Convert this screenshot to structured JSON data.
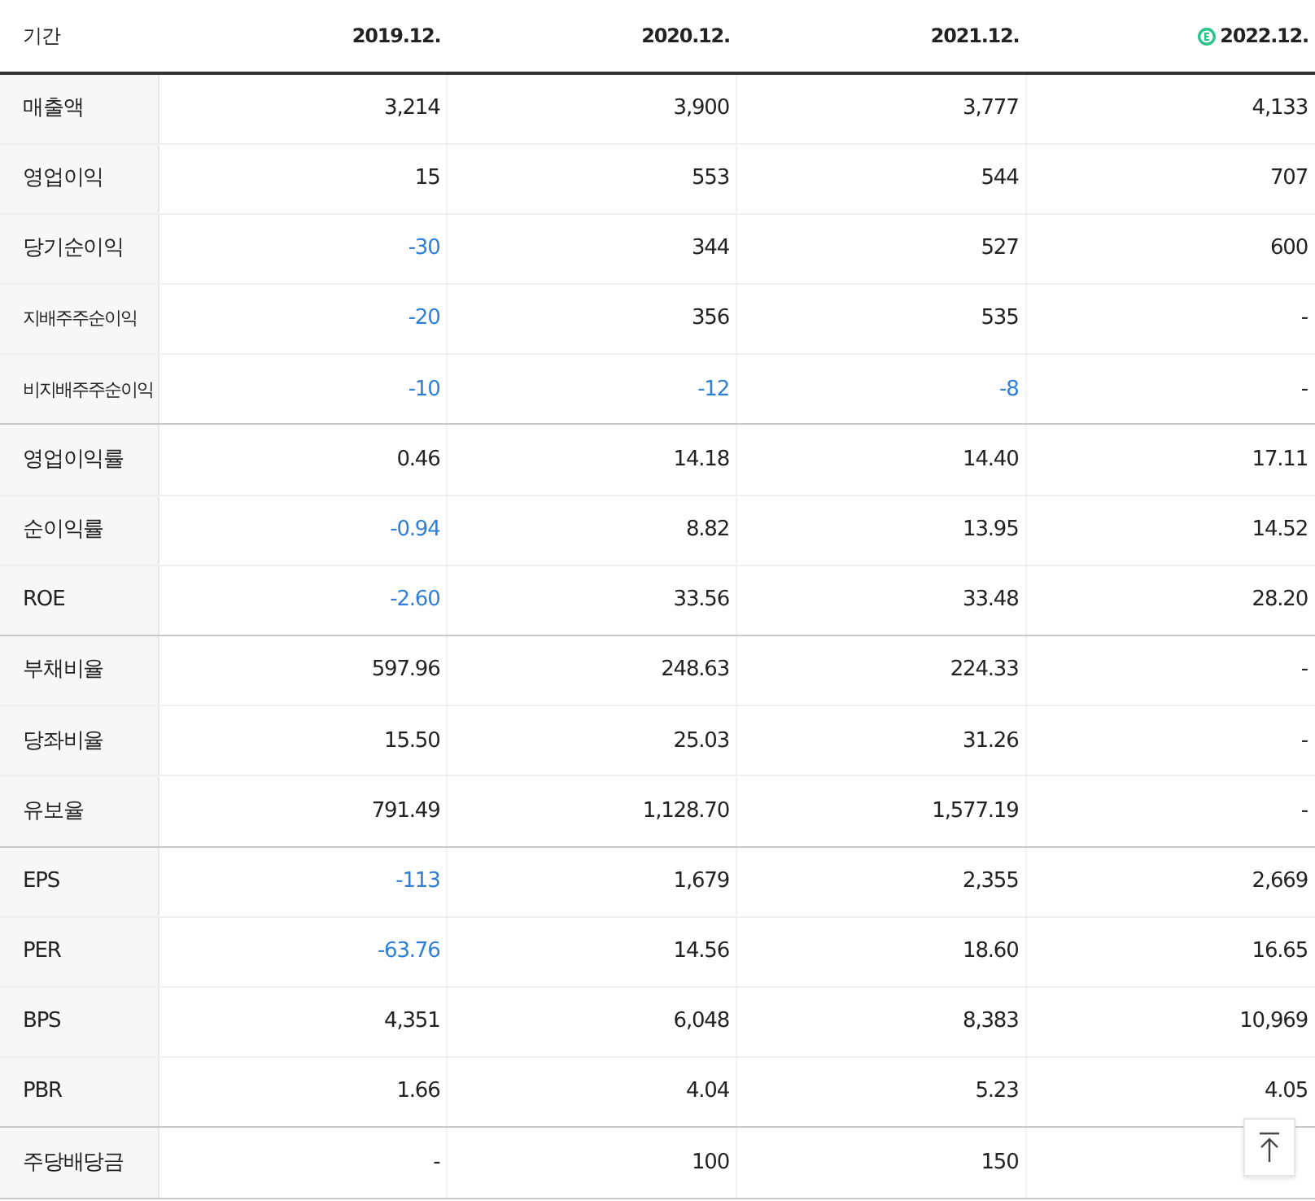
{
  "table": {
    "columns": [
      {
        "label": "기간",
        "estimate": false
      },
      {
        "label": "2019.12.",
        "estimate": false
      },
      {
        "label": "2020.12.",
        "estimate": false
      },
      {
        "label": "2021.12.",
        "estimate": false
      },
      {
        "label": "2022.12.",
        "estimate": true
      }
    ],
    "groups": [
      {
        "rows": [
          {
            "label": "매출액",
            "kind": "main",
            "cells": [
              {
                "text": "3,214",
                "negative": false
              },
              {
                "text": "3,900",
                "negative": false
              },
              {
                "text": "3,777",
                "negative": false
              },
              {
                "text": "4,133",
                "negative": false
              }
            ]
          },
          {
            "label": "영업이익",
            "kind": "main",
            "cells": [
              {
                "text": "15",
                "negative": false
              },
              {
                "text": "553",
                "negative": false
              },
              {
                "text": "544",
                "negative": false
              },
              {
                "text": "707",
                "negative": false
              }
            ]
          },
          {
            "label": "당기순이익",
            "kind": "main",
            "cells": [
              {
                "text": "-30",
                "negative": true
              },
              {
                "text": "344",
                "negative": false
              },
              {
                "text": "527",
                "negative": false
              },
              {
                "text": "600",
                "negative": false
              }
            ]
          },
          {
            "label": "지배주주순이익",
            "kind": "sub",
            "cells": [
              {
                "text": "-20",
                "negative": true
              },
              {
                "text": "356",
                "negative": false
              },
              {
                "text": "535",
                "negative": false
              },
              {
                "text": "-",
                "negative": false
              }
            ]
          },
          {
            "label": "비지배주주순이익",
            "kind": "sub",
            "cells": [
              {
                "text": "-10",
                "negative": true
              },
              {
                "text": "-12",
                "negative": true
              },
              {
                "text": "-8",
                "negative": true
              },
              {
                "text": "-",
                "negative": false
              }
            ]
          }
        ]
      },
      {
        "rows": [
          {
            "label": "영업이익률",
            "kind": "main",
            "cells": [
              {
                "text": "0.46",
                "negative": false
              },
              {
                "text": "14.18",
                "negative": false
              },
              {
                "text": "14.40",
                "negative": false
              },
              {
                "text": "17.11",
                "negative": false
              }
            ]
          },
          {
            "label": "순이익률",
            "kind": "main",
            "cells": [
              {
                "text": "-0.94",
                "negative": true
              },
              {
                "text": "8.82",
                "negative": false
              },
              {
                "text": "13.95",
                "negative": false
              },
              {
                "text": "14.52",
                "negative": false
              }
            ]
          },
          {
            "label": "ROE",
            "kind": "main",
            "cells": [
              {
                "text": "-2.60",
                "negative": true
              },
              {
                "text": "33.56",
                "negative": false
              },
              {
                "text": "33.48",
                "negative": false
              },
              {
                "text": "28.20",
                "negative": false
              }
            ]
          }
        ]
      },
      {
        "rows": [
          {
            "label": "부채비율",
            "kind": "main",
            "cells": [
              {
                "text": "597.96",
                "negative": false
              },
              {
                "text": "248.63",
                "negative": false
              },
              {
                "text": "224.33",
                "negative": false
              },
              {
                "text": "-",
                "negative": false
              }
            ]
          },
          {
            "label": "당좌비율",
            "kind": "main",
            "cells": [
              {
                "text": "15.50",
                "negative": false
              },
              {
                "text": "25.03",
                "negative": false
              },
              {
                "text": "31.26",
                "negative": false
              },
              {
                "text": "-",
                "negative": false
              }
            ]
          },
          {
            "label": "유보율",
            "kind": "main",
            "cells": [
              {
                "text": "791.49",
                "negative": false
              },
              {
                "text": "1,128.70",
                "negative": false
              },
              {
                "text": "1,577.19",
                "negative": false
              },
              {
                "text": "-",
                "negative": false
              }
            ]
          }
        ]
      },
      {
        "rows": [
          {
            "label": "EPS",
            "kind": "main",
            "cells": [
              {
                "text": "-113",
                "negative": true
              },
              {
                "text": "1,679",
                "negative": false
              },
              {
                "text": "2,355",
                "negative": false
              },
              {
                "text": "2,669",
                "negative": false
              }
            ]
          },
          {
            "label": "PER",
            "kind": "main",
            "cells": [
              {
                "text": "-63.76",
                "negative": true
              },
              {
                "text": "14.56",
                "negative": false
              },
              {
                "text": "18.60",
                "negative": false
              },
              {
                "text": "16.65",
                "negative": false
              }
            ]
          },
          {
            "label": "BPS",
            "kind": "main",
            "cells": [
              {
                "text": "4,351",
                "negative": false
              },
              {
                "text": "6,048",
                "negative": false
              },
              {
                "text": "8,383",
                "negative": false
              },
              {
                "text": "10,969",
                "negative": false
              }
            ]
          },
          {
            "label": "PBR",
            "kind": "main",
            "cells": [
              {
                "text": "1.66",
                "negative": false
              },
              {
                "text": "4.04",
                "negative": false
              },
              {
                "text": "5.23",
                "negative": false
              },
              {
                "text": "4.05",
                "negative": false
              }
            ]
          }
        ]
      },
      {
        "rows": [
          {
            "label": "주당배당금",
            "kind": "main",
            "cells": [
              {
                "text": "-",
                "negative": false
              },
              {
                "text": "100",
                "negative": false
              },
              {
                "text": "150",
                "negative": false
              }
            ]
          }
        ]
      }
    ]
  },
  "scroll_top_button": {
    "visible": true
  }
}
